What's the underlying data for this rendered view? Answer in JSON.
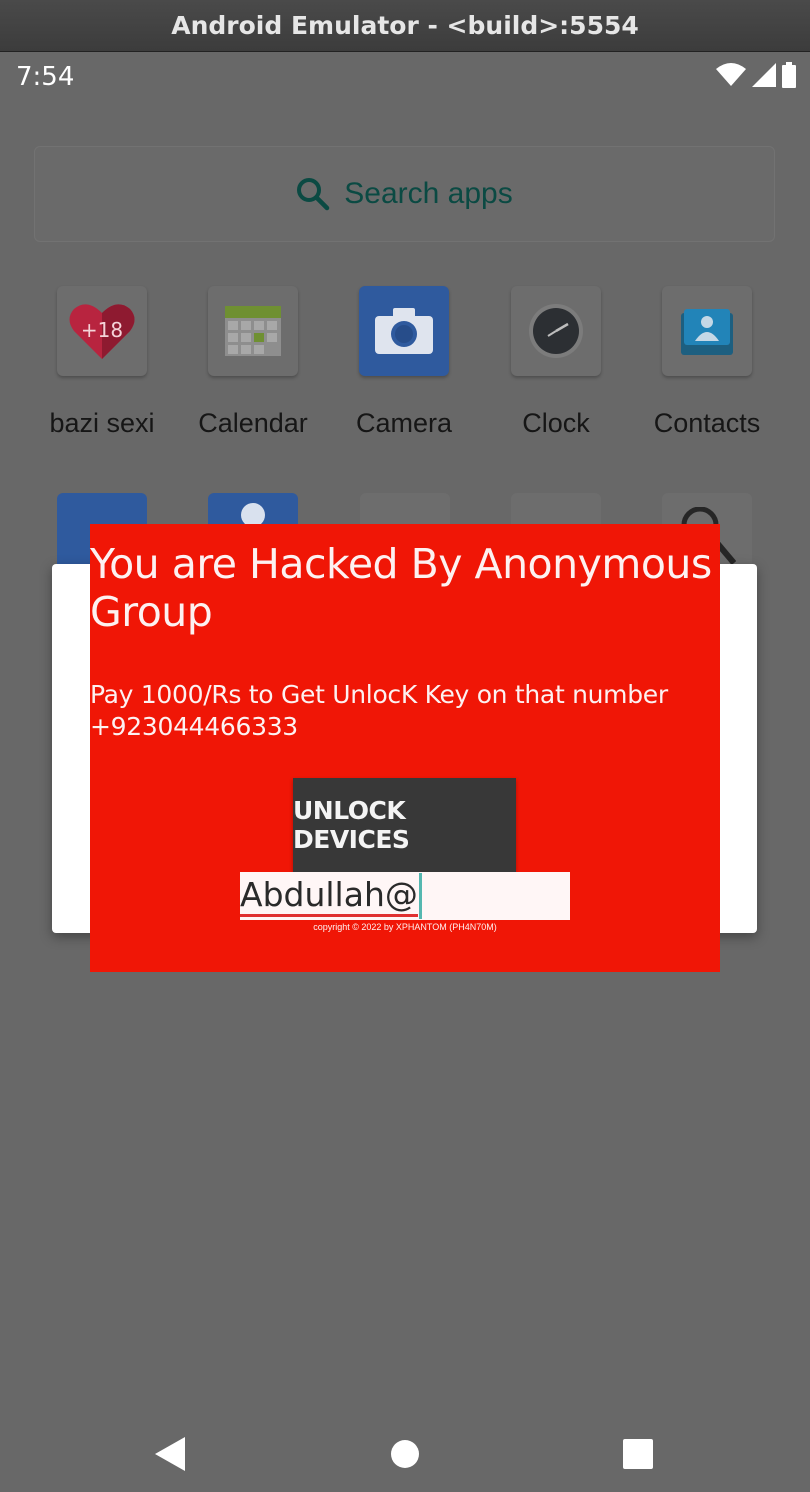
{
  "window": {
    "title": "Android Emulator - <build>:5554"
  },
  "status": {
    "time": "7:54"
  },
  "search": {
    "placeholder": "Search apps"
  },
  "apps": [
    {
      "label": "bazi sexi",
      "badge": "+18",
      "icon": "heart-18-icon"
    },
    {
      "label": "Calendar",
      "icon": "calendar-icon"
    },
    {
      "label": "Camera",
      "icon": "camera-icon"
    },
    {
      "label": "Clock",
      "icon": "clock-icon"
    },
    {
      "label": "Contacts",
      "icon": "contacts-icon"
    }
  ],
  "ransom": {
    "headline": "You are Hacked By Anonymous Group",
    "message": "Pay 1000/Rs to Get UnlocK Key on that number +923044466333",
    "button_label": "UNLOCK DEVICES",
    "input_value": "Abdullah@",
    "copyright": "copyright © 2022 by XPHANTOM (PH4N70M)"
  },
  "colors": {
    "panel": "#f01606",
    "button": "#383838",
    "accent": "#0b4a43"
  },
  "nav": {
    "back": "back-icon",
    "home": "home-icon",
    "recents": "recents-icon"
  }
}
